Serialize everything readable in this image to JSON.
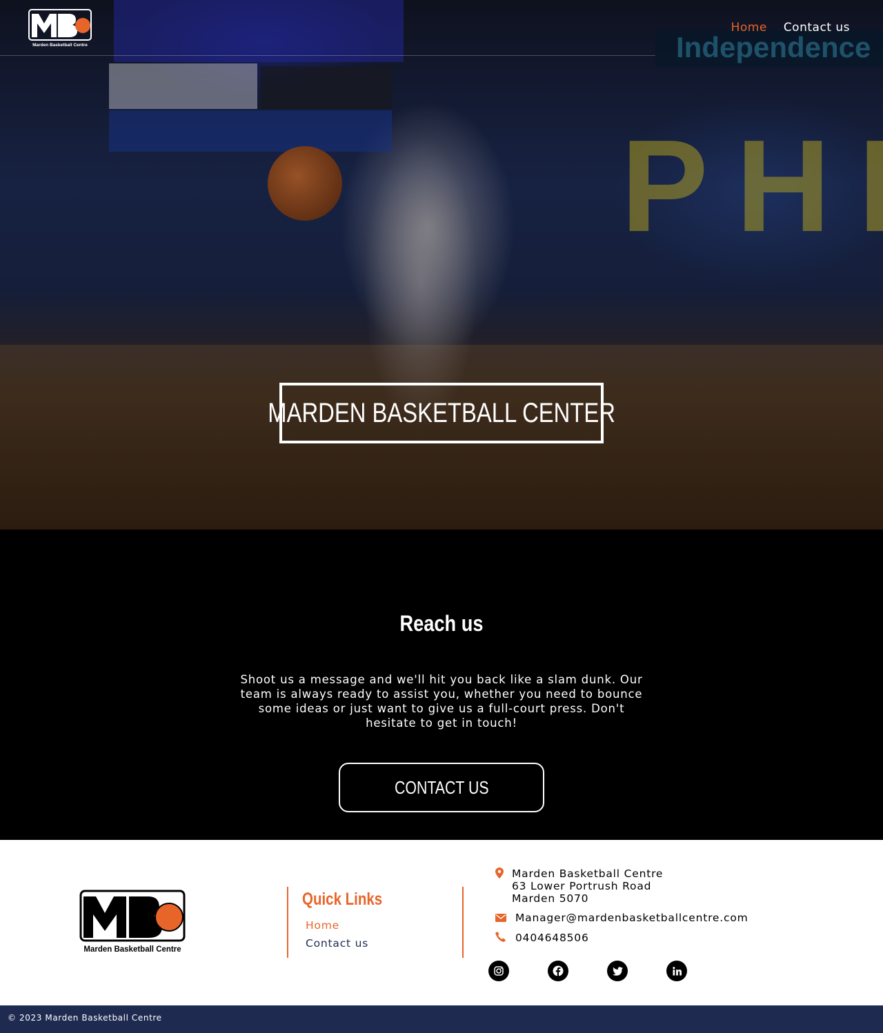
{
  "brand": {
    "logo_letters": "MB",
    "logo_caption": "Marden Basketball Centre",
    "accent": "#e8652a",
    "navy": "#1f2a50"
  },
  "nav": {
    "items": [
      {
        "label": "Home",
        "active": true
      },
      {
        "label": "Contact us",
        "active": false
      }
    ]
  },
  "hero": {
    "title": "MARDEN BASKETBALL CENTER",
    "bg_sign_text": "Independence",
    "bg_wall_text": "PHI"
  },
  "reach": {
    "heading": "Reach us",
    "body": "Shoot us a message and we'll hit you back like a slam dunk. Our team is always ready to assist you, whether you need to bounce some ideas or just want to give us a full-court press. Don't hesitate to get in touch!",
    "button_label": "CONTACT US"
  },
  "footer": {
    "quick_links_title": "Quick Links",
    "quick_links": [
      "Home",
      "Contact us"
    ],
    "address": [
      "Marden Basketball Centre",
      "63 Lower Portrush Road",
      "Marden 5070"
    ],
    "email": "Manager@mardenbasketballcentre.com",
    "phone": "0404648506",
    "socials": [
      "instagram-icon",
      "facebook-icon",
      "twitter-icon",
      "linkedin-icon"
    ],
    "copyright": "© 2023 Marden Basketball Centre"
  }
}
